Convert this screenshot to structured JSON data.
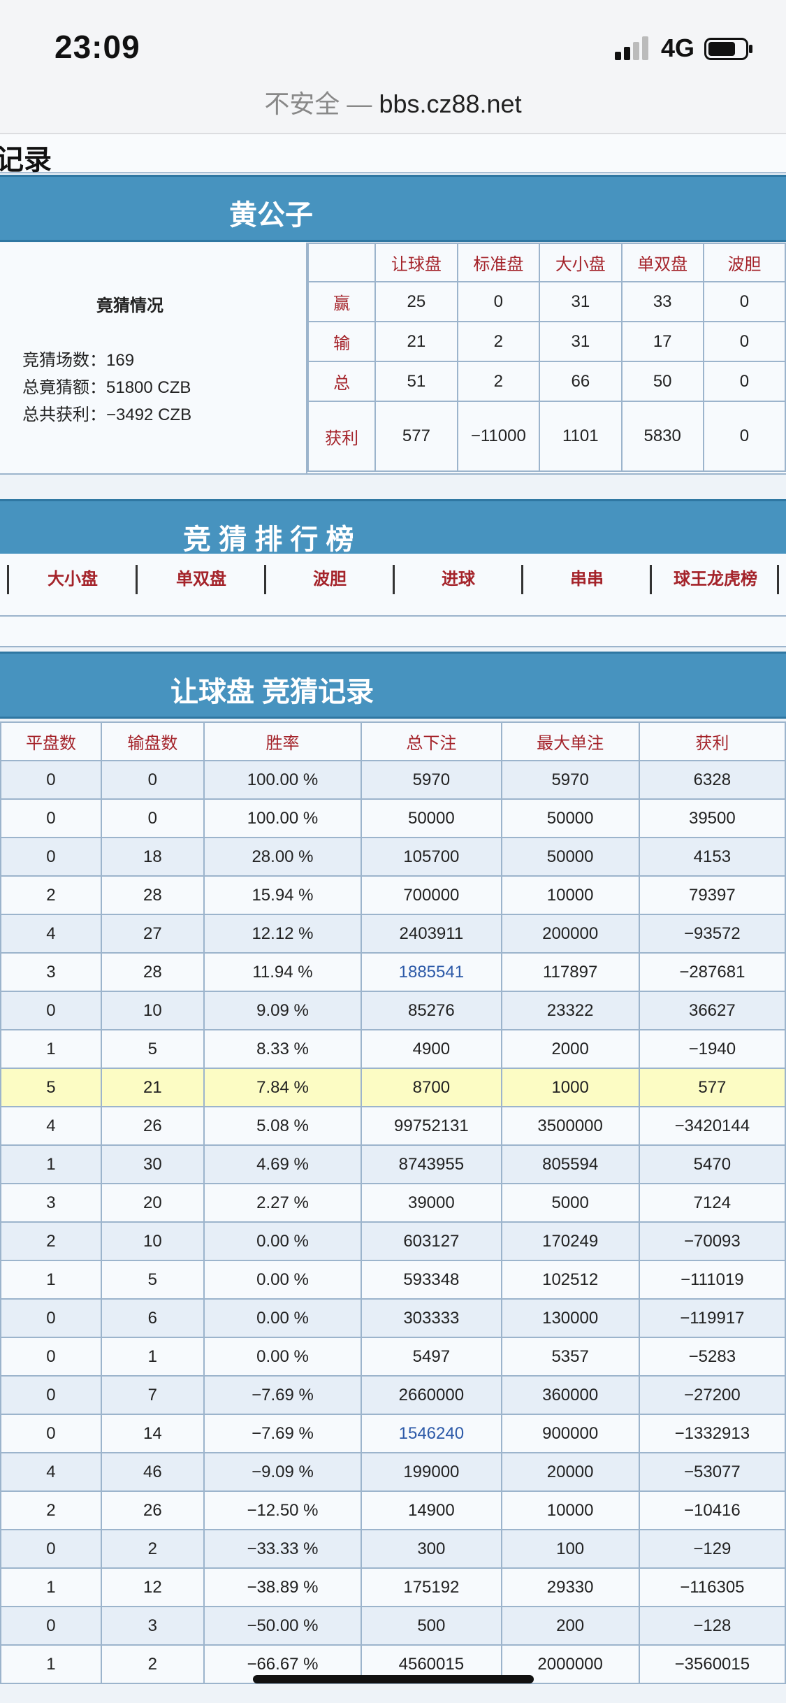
{
  "status_bar": {
    "time": "23:09",
    "network": "4G"
  },
  "url_bar": {
    "insecure_label": "不安全 —",
    "domain": "bbs.cz88.net"
  },
  "page_heading": "记录",
  "profile": {
    "name": "黄公子",
    "summary_title": "竟猜情况",
    "lines": [
      "竞猜场数：169",
      "总竟猜额：51800 CZB",
      "总共获利：−3492 CZB"
    ],
    "stats_headers": [
      "让球盘",
      "标准盘",
      "大小盘",
      "单双盘",
      "波胆"
    ],
    "stats_rows": [
      {
        "label": "赢",
        "values": [
          "25",
          "0",
          "31",
          "33",
          "0"
        ]
      },
      {
        "label": "输",
        "values": [
          "21",
          "2",
          "31",
          "17",
          "0"
        ]
      },
      {
        "label": "总",
        "values": [
          "51",
          "2",
          "66",
          "50",
          "0"
        ]
      },
      {
        "label": "获利",
        "values": [
          "577",
          "−11000",
          "1101",
          "5830",
          "0"
        ]
      }
    ]
  },
  "ranking": {
    "title": "竞 猜 排 行 榜",
    "tabs": [
      "大小盘",
      "单双盘",
      "波胆",
      "进球",
      "串串",
      "球王龙虎榜"
    ]
  },
  "records": {
    "title": "让球盘 竞猜记录",
    "headers": [
      "平盘数",
      "输盘数",
      "胜率",
      "总下注",
      "最大单注",
      "获利"
    ],
    "rows": [
      [
        "0",
        "0",
        "100.00 %",
        "5970",
        "5970",
        "6328"
      ],
      [
        "0",
        "0",
        "100.00 %",
        "50000",
        "50000",
        "39500"
      ],
      [
        "0",
        "18",
        "28.00 %",
        "105700",
        "50000",
        "4153"
      ],
      [
        "2",
        "28",
        "15.94 %",
        "700000",
        "10000",
        "79397"
      ],
      [
        "4",
        "27",
        "12.12 %",
        "2403911",
        "200000",
        "−93572"
      ],
      [
        "3",
        "28",
        "11.94 %",
        "1885541",
        "117897",
        "−287681"
      ],
      [
        "0",
        "10",
        "9.09 %",
        "85276",
        "23322",
        "36627"
      ],
      [
        "1",
        "5",
        "8.33 %",
        "4900",
        "2000",
        "−1940"
      ],
      [
        "5",
        "21",
        "7.84 %",
        "8700",
        "1000",
        "577"
      ],
      [
        "4",
        "26",
        "5.08 %",
        "99752131",
        "3500000",
        "−3420144"
      ],
      [
        "1",
        "30",
        "4.69 %",
        "8743955",
        "805594",
        "5470"
      ],
      [
        "3",
        "20",
        "2.27 %",
        "39000",
        "5000",
        "7124"
      ],
      [
        "2",
        "10",
        "0.00 %",
        "603127",
        "170249",
        "−70093"
      ],
      [
        "1",
        "5",
        "0.00 %",
        "593348",
        "102512",
        "−111019"
      ],
      [
        "0",
        "6",
        "0.00 %",
        "303333",
        "130000",
        "−119917"
      ],
      [
        "0",
        "1",
        "0.00 %",
        "5497",
        "5357",
        "−5283"
      ],
      [
        "0",
        "7",
        "−7.69 %",
        "2660000",
        "360000",
        "−27200"
      ],
      [
        "0",
        "14",
        "−7.69 %",
        "1546240",
        "900000",
        "−1332913"
      ],
      [
        "4",
        "46",
        "−9.09 %",
        "199000",
        "20000",
        "−53077"
      ],
      [
        "2",
        "26",
        "−12.50 %",
        "14900",
        "10000",
        "−10416"
      ],
      [
        "0",
        "2",
        "−33.33 %",
        "300",
        "100",
        "−129"
      ],
      [
        "1",
        "12",
        "−38.89 %",
        "175192",
        "29330",
        "−116305"
      ],
      [
        "0",
        "3",
        "−50.00 %",
        "500",
        "200",
        "−128"
      ],
      [
        "1",
        "2",
        "−66.67 %",
        "4560015",
        "2000000",
        "−3560015"
      ]
    ],
    "highlight_row": 8,
    "link_cells": [
      [
        5,
        3
      ],
      [
        17,
        3
      ]
    ]
  },
  "colors": {
    "header_blue": "#4793bf",
    "label_red": "#a4232a",
    "row_alt": "#e6eef7",
    "row_highlight": "#fcfcc4",
    "link_blue": "#2d5aa8"
  },
  "icons": [
    "signal-icon",
    "battery-icon"
  ]
}
